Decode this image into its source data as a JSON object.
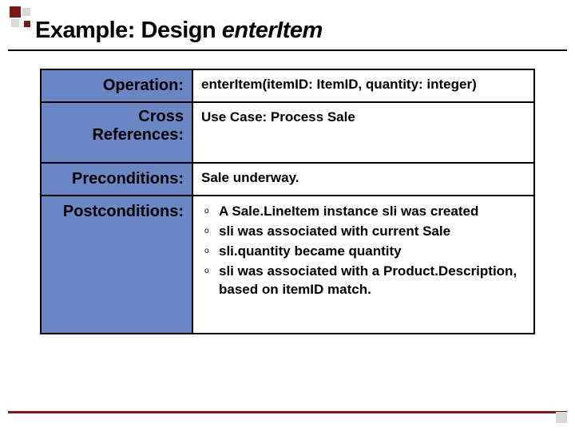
{
  "title": {
    "prefix": "Example: Design ",
    "italic": "enterItem"
  },
  "rows": {
    "operation": {
      "label": "Operation:",
      "value": "enterItem(itemID: ItemID, quantity: integer)"
    },
    "cross": {
      "label1": "Cross",
      "label2": "References:",
      "value": "Use Case: Process Sale"
    },
    "pre": {
      "label": "Preconditions:",
      "value": "Sale underway."
    },
    "post": {
      "label": "Postconditions:",
      "items": [
        "A Sale.LineItem instance sli was created",
        "sli was associated with current Sale",
        "sli.quantity became quantity",
        "sli was associated with a Product.Description, based on itemID match."
      ]
    }
  }
}
